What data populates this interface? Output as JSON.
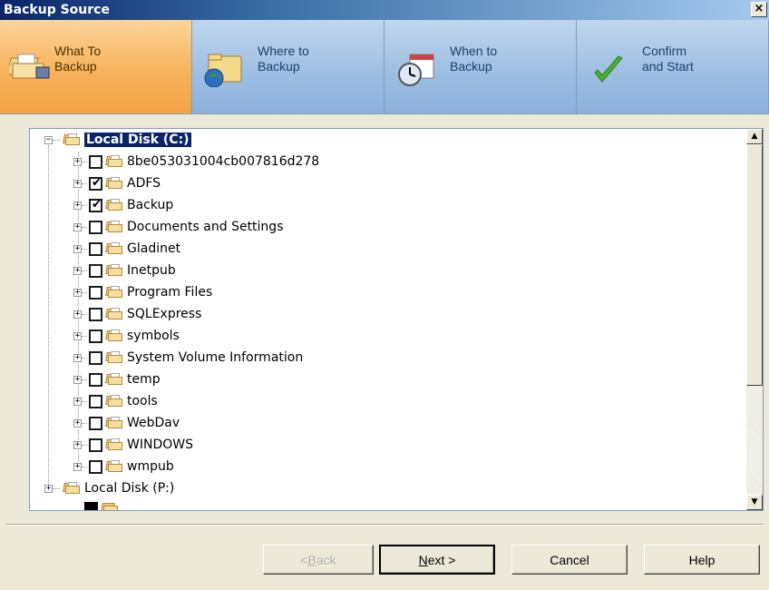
{
  "window": {
    "title": "Backup Source",
    "close_label": "×"
  },
  "steps": [
    {
      "label": "What To\nBackup",
      "icon": "backup-folders-icon",
      "active": true
    },
    {
      "label": "Where to\nBackup",
      "icon": "globe-folder-icon",
      "active": false
    },
    {
      "label": "When to\nBackup",
      "icon": "clock-calendar-icon",
      "active": false
    },
    {
      "label": "Confirm\nand Start",
      "icon": "checkmark-icon",
      "active": false
    }
  ],
  "tree": {
    "root": {
      "label": "Local Disk (C:)",
      "expanded": true,
      "selected": true
    },
    "children": [
      {
        "label": "8be053031004cb007816d278",
        "checked": false
      },
      {
        "label": "ADFS",
        "checked": true
      },
      {
        "label": "Backup",
        "checked": true
      },
      {
        "label": "Documents and Settings",
        "checked": false
      },
      {
        "label": "Gladinet",
        "checked": false
      },
      {
        "label": "Inetpub",
        "checked": false
      },
      {
        "label": "Program Files",
        "checked": false
      },
      {
        "label": "SQLExpress",
        "checked": false
      },
      {
        "label": "symbols",
        "checked": false
      },
      {
        "label": "System Volume Information",
        "checked": false
      },
      {
        "label": "temp",
        "checked": false
      },
      {
        "label": "tools",
        "checked": false
      },
      {
        "label": "WebDav",
        "checked": false
      },
      {
        "label": "WINDOWS",
        "checked": false
      },
      {
        "label": "wmpub",
        "checked": false
      }
    ],
    "second_root": {
      "label": "Local Disk (P:)",
      "expanded": false
    }
  },
  "buttons": {
    "back": {
      "pre": "< ",
      "accel": "B",
      "post": "ack"
    },
    "next": {
      "pre": "",
      "accel": "N",
      "post": "ext >"
    },
    "cancel": "Cancel",
    "help": "Help"
  }
}
